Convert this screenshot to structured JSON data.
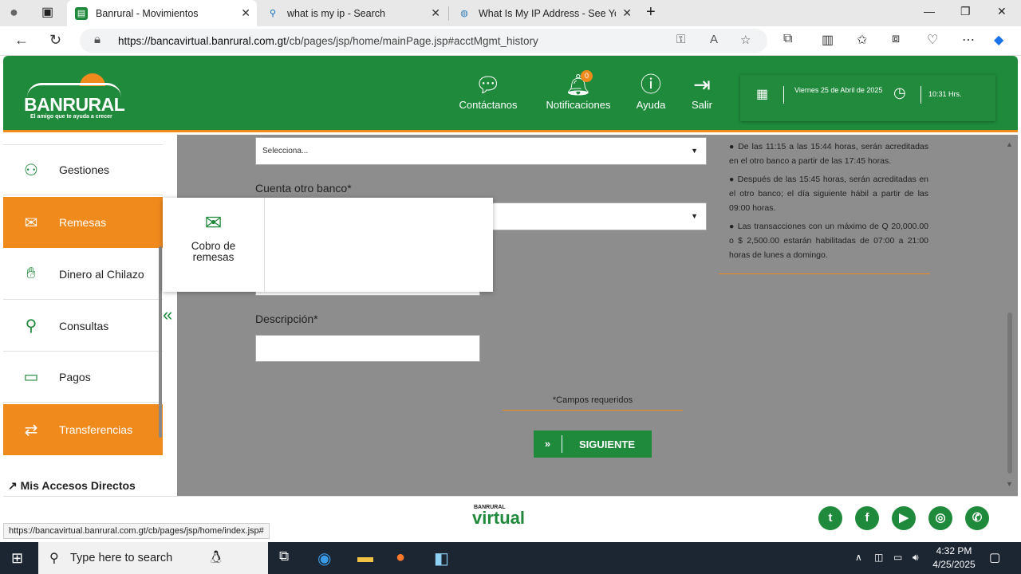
{
  "browser": {
    "tabs": [
      {
        "title": "Banrural - Movimientos",
        "icon": "banrural-favicon"
      },
      {
        "title": "what is my ip - Search",
        "icon": "search-favicon"
      },
      {
        "title": "What Is My IP Address - See Your",
        "icon": "globe-favicon"
      }
    ],
    "url_host": "https://bancavirtual.banrural.com.gt",
    "url_path": "/cb/pages/jsp/home/mainPage.jsp#acctMgmt_history"
  },
  "header": {
    "logo_name": "BANRURAL",
    "logo_tagline": "El amigo que te ayuda a crecer",
    "nav": [
      {
        "label": "Contáctanos",
        "icon": "chat-icon"
      },
      {
        "label": "Notificaciones",
        "icon": "bell-icon",
        "badge": "0"
      },
      {
        "label": "Ayuda",
        "icon": "help-icon"
      },
      {
        "label": "Salir",
        "icon": "logout-icon"
      }
    ],
    "date": "Viernes 25 de Abril de 2025",
    "time": "10:31 Hrs."
  },
  "sidebar": {
    "items": [
      {
        "label": "Gestiones",
        "icon": "people-desk-icon",
        "active": false
      },
      {
        "label": "Remesas",
        "icon": "remittance-icon",
        "active": true
      },
      {
        "label": "Dinero al Chilazo",
        "icon": "money-hand-icon",
        "active": false
      },
      {
        "label": "Consultas",
        "icon": "search-icon",
        "active": false
      },
      {
        "label": "Pagos",
        "icon": "cash-icon",
        "active": false
      },
      {
        "label": "Transferencias",
        "icon": "transfer-icon",
        "active": true
      }
    ],
    "accesos": "Mis Accesos Directos"
  },
  "popup": {
    "item_label": "Cobro de remesas",
    "item_icon": "remittance-collect-icon"
  },
  "form": {
    "select_placeholder": "Selecciona...",
    "label_cuenta": "Cuenta otro banco*",
    "label_descripcion": "Descripción*",
    "required_note": "*Campos requeridos",
    "next_button": "SIGUIENTE",
    "next_arrow": "»"
  },
  "info": [
    "De las 11:15 a las 15:44 horas, serán acreditadas en el otro banco a partir de las 17:45 horas.",
    "Después de las 15:45 horas, serán acreditadas en el otro banco; el día siguiente hábil a partir de las 09:00 horas.",
    "Las transacciones con un máximo de Q 20,000.00 o $ 2,500.00 estarán habilitadas de 07:00 a 21:00 horas de lunes a domingo."
  ],
  "footer": {
    "logo_small": "BANRURAL",
    "logo_big": "virtual",
    "social": [
      "twitter",
      "facebook",
      "youtube",
      "instagram",
      "whatsapp"
    ]
  },
  "status_url": "https://bancavirtual.banrural.com.gt/cb/pages/jsp/home/index.jsp#",
  "taskbar": {
    "search_placeholder": "Type here to search",
    "time": "4:32 PM",
    "date": "4/25/2025"
  }
}
